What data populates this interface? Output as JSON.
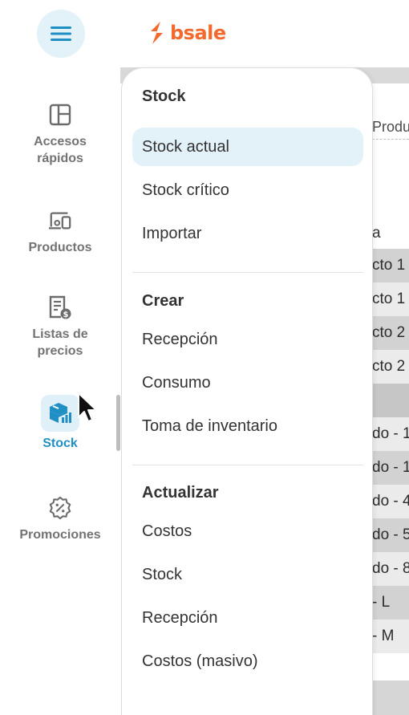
{
  "brand": {
    "name": "bsale",
    "color": "#f26a2e",
    "accent": "#1f8fc4"
  },
  "topbar": {
    "menu_icon": "hamburger-icon"
  },
  "rail": {
    "items": [
      {
        "label_line1": "Accesos",
        "label_line2": "rápidos",
        "icon": "layout-grid-icon",
        "active": false
      },
      {
        "label_line1": "Productos",
        "label_line2": "",
        "icon": "devices-icon",
        "active": false
      },
      {
        "label_line1": "Listas de",
        "label_line2": "precios",
        "icon": "price-list-icon",
        "active": false
      },
      {
        "label_line1": "Stock",
        "label_line2": "",
        "icon": "stock-box-icon",
        "active": true
      },
      {
        "label_line1": "Promociones",
        "label_line2": "",
        "icon": "discount-badge-icon",
        "active": false
      }
    ]
  },
  "menu": {
    "sections": [
      {
        "title": "Stock",
        "items": [
          "Stock actual",
          "Stock crítico",
          "Importar"
        ]
      },
      {
        "title": "Crear",
        "items": [
          "Recepción",
          "Consumo",
          "Toma de inventario"
        ]
      },
      {
        "title": "Actualizar",
        "items": [
          "Costos",
          "Stock",
          "Recepción",
          "Costos (masivo)"
        ]
      }
    ],
    "active_item": "Stock actual"
  },
  "background": {
    "tab": "Produ",
    "column": "a",
    "rows": [
      "cto 1",
      "cto 1",
      "cto 2",
      "cto 2"
    ],
    "rows2": [
      "do - 1",
      "do - 1",
      "do - 4",
      "do - 5",
      "do - 8",
      "- L",
      "- M"
    ]
  }
}
